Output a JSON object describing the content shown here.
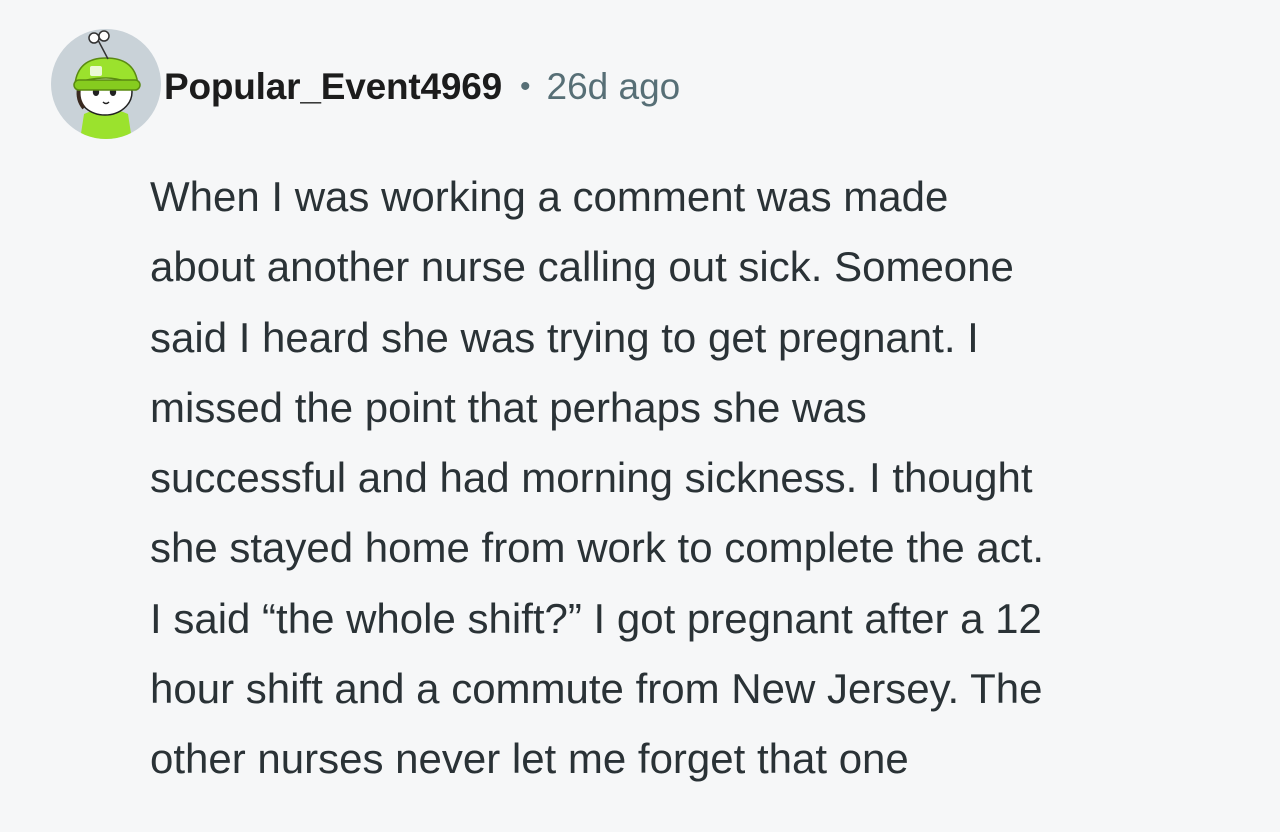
{
  "comment": {
    "username": "Popular_Event4969",
    "separator": "•",
    "timestamp": "26d ago",
    "avatar_icon": "snoo-avatar-green-beanie",
    "colors": {
      "background": "#f6f7f8",
      "username": "#1c1c1c",
      "meta": "#576f76",
      "body": "#2a3236",
      "avatar_bg": "#c9d2d8",
      "avatar_hat": "#9be22d"
    },
    "body_lines": [
      "When I was working a comment was made",
      "about another nurse calling out sick. Someone",
      "said I heard she was trying to get pregnant. I",
      "missed the point that perhaps she was",
      "successful and had morning sickness. I thought",
      "she stayed home from work to complete the act.",
      "I said “the whole shift?” I got pregnant after a 12",
      "hour shift and a commute from New Jersey. The",
      "other nurses never let me forget that one"
    ]
  }
}
